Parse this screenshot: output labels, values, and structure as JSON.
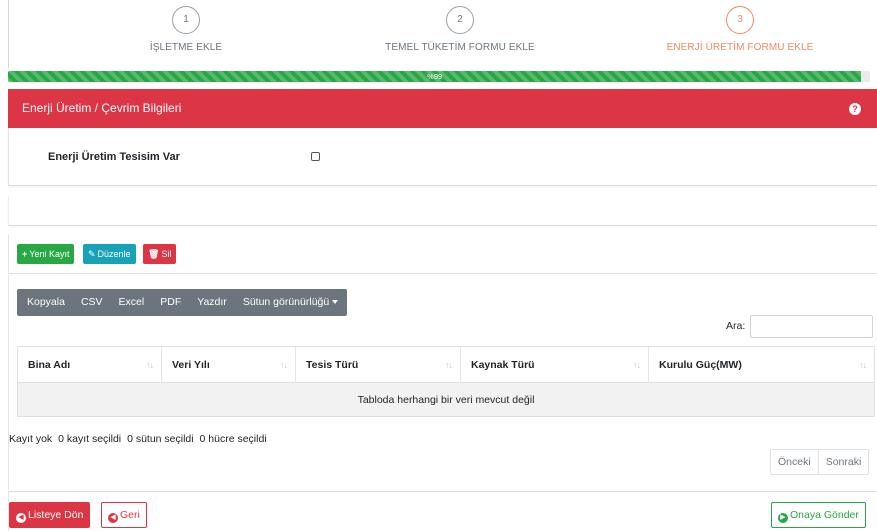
{
  "stepper": {
    "steps": [
      {
        "number": "1",
        "label": "İŞLETME EKLE"
      },
      {
        "number": "2",
        "label": "TEMEL TÜKETİM FORMU EKLE"
      },
      {
        "number": "3",
        "label": "ENERJİ ÜRETİM FORMU EKLE"
      }
    ],
    "active_step": 3
  },
  "progress": {
    "label": "%99",
    "value_percent": 99
  },
  "section": {
    "title": "Enerji Üretim / Çevrim Bilgileri",
    "help_icon": "question-circle-icon",
    "field_label": "Enerji Üretim Tesisim Var",
    "field_checked": false
  },
  "actions": {
    "new_label": "Yeni Kayıt",
    "edit_label": "Düzenle",
    "delete_label": "Sil"
  },
  "datatable": {
    "buttons": [
      "Kopyala",
      "CSV",
      "Excel",
      "PDF",
      "Yazdır",
      "Sütun görünürlüğü"
    ],
    "search_label": "Ara:",
    "search_value": "",
    "columns": [
      "Bina Adı",
      "Veri Yılı",
      "Tesis Türü",
      "Kaynak Türü",
      "Kurulu Güç(MW)"
    ],
    "empty_message": "Tabloda herhangi bir veri mevcut değil",
    "info": {
      "records": "Kayıt yok",
      "rows_selected": "0 kayıt seçildi",
      "cols_selected": "0 sütun seçildi",
      "cells_selected": "0 hücre seçildi"
    },
    "pager": {
      "prev": "Önceki",
      "next": "Sonraki"
    }
  },
  "footer": {
    "back_to_list": "Listeye Dön",
    "back": "Geri",
    "submit": "Onaya Gönder"
  },
  "colors": {
    "danger": "#dc3545",
    "success": "#28a745",
    "info": "#17a2b8",
    "secondary": "#6c757d",
    "active_step": "#f08a5d"
  }
}
